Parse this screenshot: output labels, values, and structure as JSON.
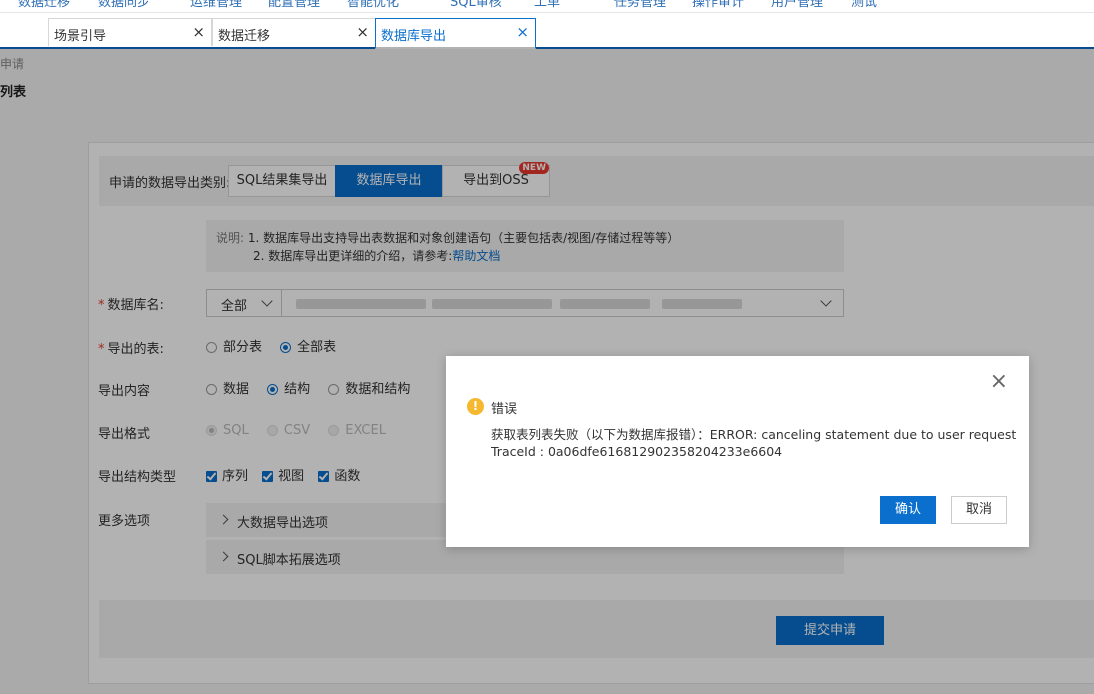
{
  "topnav": {
    "items": [
      "数据迁移",
      "数据同步",
      "运维管理",
      "配置管理",
      "智能优化",
      "SQL审核",
      "工单",
      "任务管理",
      "操作审计",
      "用户管理",
      "测试"
    ]
  },
  "tabs": [
    {
      "label": "场景引导",
      "close": "×"
    },
    {
      "label": "数据迁移",
      "close": "×"
    },
    {
      "label": "数据库导出",
      "close": "×"
    }
  ],
  "breadcrumb": {
    "parent": "申请",
    "current": "列表"
  },
  "form": {
    "type_label": "申请的数据导出类别:",
    "types": [
      {
        "label": "SQL结果集导出"
      },
      {
        "label": "数据库导出"
      },
      {
        "label": "导出到OSS",
        "badge": "NEW"
      }
    ],
    "note_prefix": "说明:",
    "note_line1": "1. 数据库导出支持导出表数据和对象创建语句（主要包括表/视图/存储过程等等）",
    "note_line2": "2. 数据库导出更详细的介绍，请参考:",
    "note_link": "帮助文档",
    "db_label": "数据库名:",
    "db_scope": "全部",
    "tables_label": "导出的表:",
    "tables_options": [
      "部分表",
      "全部表"
    ],
    "content_label": "导出内容",
    "content_options": [
      "数据",
      "结构",
      "数据和结构"
    ],
    "format_label": "导出格式",
    "format_options": [
      "SQL",
      "CSV",
      "EXCEL"
    ],
    "struct_label": "导出结构类型",
    "struct_options": [
      "序列",
      "视图",
      "函数"
    ],
    "more_label": "更多选项",
    "more_items": [
      "大数据导出选项",
      "SQL脚本拓展选项"
    ],
    "submit": "提交申请"
  },
  "dialog": {
    "close": "×",
    "icon": "!",
    "title": "错误",
    "message": "获取表列表失败（以下为数据库报错）：ERROR: canceling statement due to user request",
    "trace": "TraceId : 0a06dfe616812902358204233e6604",
    "ok": "确认",
    "cancel": "取消"
  },
  "colors": {
    "accent": "#0a6fcd",
    "warning": "#f5b82e",
    "danger": "#e8382f"
  }
}
